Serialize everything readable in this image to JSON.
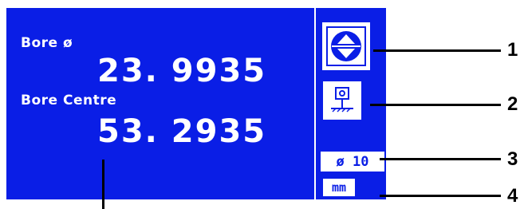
{
  "display": {
    "bore_label": "Bore ø",
    "bore_value": "23. 9935",
    "centre_label": "Bore Centre",
    "centre_value": "53. 2935"
  },
  "buttons": {
    "mode_icon": "up-down-arrows-icon",
    "probe_icon": "probe-icon",
    "diameter_label": "ø 10",
    "units_label": "mm"
  },
  "callouts": {
    "one": "1",
    "two": "2",
    "three": "3",
    "four": "4"
  },
  "colors": {
    "screen": "#0a1ee6",
    "text": "#ffffff"
  }
}
